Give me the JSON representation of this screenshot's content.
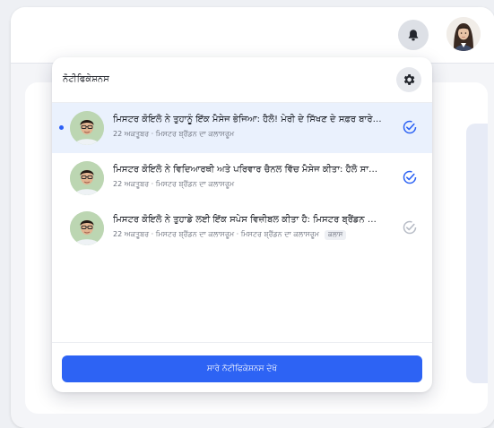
{
  "header": {
    "user_avatar": "user-avatar-woman"
  },
  "notifications_panel": {
    "title": "ਨੋਟੀਫਿਕੇਸ਼ਨਸ",
    "items": [
      {
        "message": "ਮਿਸਟਰ ਕੋਇਲੋ ਨੇ ਤੁਹਾਨੂੰ ਇੱਕ ਮੈਸੇਜ ਭੇਜਿਆ: ਹੈਲੋ! ਮੇਰੀ ਦੇ ਸਿੱਖਣ ਦੇ ਸਫ਼ਰ ਬਾਰੇ ਚ...",
        "meta": "22 ਅਕਤੂਬਰ · ਮਿਸਟਰ ਬ੍ਰੈਂਡਨ ਦਾ ਕਲਾਸਰੂਮ",
        "tag": "",
        "unread": true
      },
      {
        "message": "ਮਿਸਟਰ ਕੋਇਲੋ ਨੇ ਵਿਦਿਆਰਥੀ ਅਤੇ ਪਰਿਵਾਰ ਚੈਨਲ ਵਿੱਚ ਮੈਸੇਜ ਕੀਤਾ: ਹੈਲੋ ਸਾਰਿਆਂ...",
        "meta": "22 ਅਕਤੂਬਰ · ਮਿਸਟਰ ਬ੍ਰੈਂਡਨ ਦਾ ਕਲਾਸਰੂਮ",
        "tag": "",
        "unread": false
      },
      {
        "message": "ਮਿਸਟਰ ਕੋਇਲੋ ਨੇ ਤੁਹਾਡੇ ਲਈ ਇੱਕ ਸਪੇਸ ਵਿਜ਼ੀਬਲ ਕੀਤਾ ਹੈ: ਮਿਸਟਰ ਬ੍ਰੈਂਡਨ ਦਾ ਕਲ...",
        "meta": "22 ਅਕਤੂਬਰ · ਮਿਸਟਰ ਬ੍ਰੈਂਡਨ ਦਾ ਕਲਾਸਰੂਮ · ਮਿਸਟਰ ਬ੍ਰੈਂਡਨ ਦਾ ਕਲਾਸਰੂਮ",
        "tag": "ਕਲਾਸ",
        "unread": false
      }
    ],
    "view_all_label": "ਸਾਰੇ ਨੋਟੀਫਿਕੇਸ਼ਨਸ ਦੇਖੋ"
  },
  "colors": {
    "accent": "#2d63f4",
    "unread_bg": "#eaf1fd",
    "check_read": "#2d63f4",
    "check_muted": "#b7bcc6"
  }
}
